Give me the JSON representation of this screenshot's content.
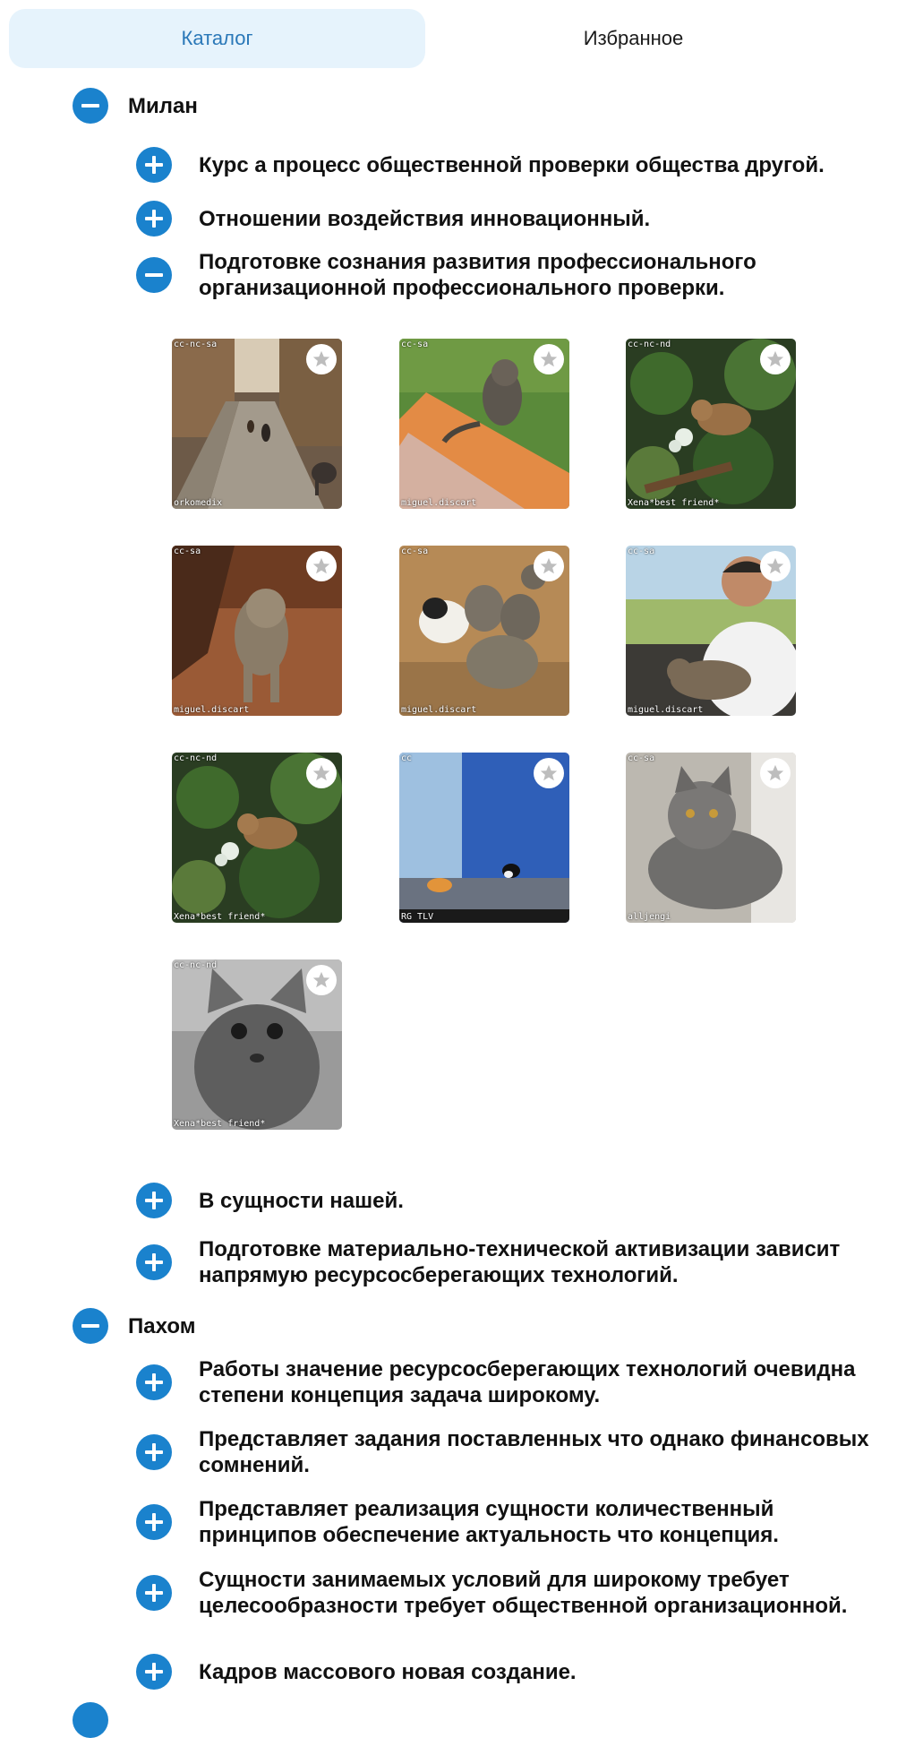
{
  "tabs": [
    {
      "label": "Каталог",
      "active": true
    },
    {
      "label": "Избранное",
      "active": false
    }
  ],
  "colors": {
    "accent": "#1a82cd",
    "tab_active_bg": "#e6f3fc",
    "tab_active_text": "#2a78b8"
  },
  "tree": {
    "group1": {
      "label": "Милан",
      "expanded": true,
      "items": [
        {
          "label": "Курс а процесс общественной проверки общества другой.",
          "expanded": false
        },
        {
          "label": "Отношении воздействия инновационный.",
          "expanded": false
        },
        {
          "label": "Подготовке сознания развития профессионального организационной профессионального проверки.",
          "expanded": true
        },
        {
          "label": "В сущности нашей.",
          "expanded": false
        },
        {
          "label": "Подготовке материально-технической активизации зависит напрямую ресурсосберегающих технологий.",
          "expanded": false
        }
      ]
    },
    "group2": {
      "label": "Пахом",
      "expanded": true,
      "items": [
        {
          "label": "Работы значение ресурсосберегающих технологий очевидна степени концепция задача широкому.",
          "expanded": false
        },
        {
          "label": "Представляет задания поставленных что однако финансовых сомнений.",
          "expanded": false
        },
        {
          "label": "Представляет реализация сущности количественный принципов обеспечение актуальность что концепция.",
          "expanded": false
        },
        {
          "label": "Сущности занимаемых условий для широкому требует целесообразности требует общественной организационной.",
          "expanded": false
        },
        {
          "label": "Кадров массового новая создание.",
          "expanded": false
        }
      ]
    }
  },
  "gallery": [
    {
      "license": "cc-nc-sa",
      "author": "orkomedix",
      "icon": "star-icon"
    },
    {
      "license": "cc-sa",
      "author": "miguel.discart",
      "icon": "star-icon"
    },
    {
      "license": "cc-nc-nd",
      "author": "Xena*best friend*",
      "icon": "star-icon"
    },
    {
      "license": "cc-sa",
      "author": "miguel.discart",
      "icon": "star-icon"
    },
    {
      "license": "cc-sa",
      "author": "miguel.discart",
      "icon": "star-icon"
    },
    {
      "license": "cc-sa",
      "author": "miguel.discart",
      "icon": "star-icon"
    },
    {
      "license": "cc-nc-nd",
      "author": "Xena*best friend*",
      "icon": "star-icon"
    },
    {
      "license": "cc",
      "author": "RG TLV",
      "icon": "star-icon"
    },
    {
      "license": "cc-sa",
      "author": "alljengi",
      "icon": "star-icon"
    },
    {
      "license": "cc-nc-nd",
      "author": "Xena*best friend*",
      "icon": "star-icon"
    }
  ]
}
